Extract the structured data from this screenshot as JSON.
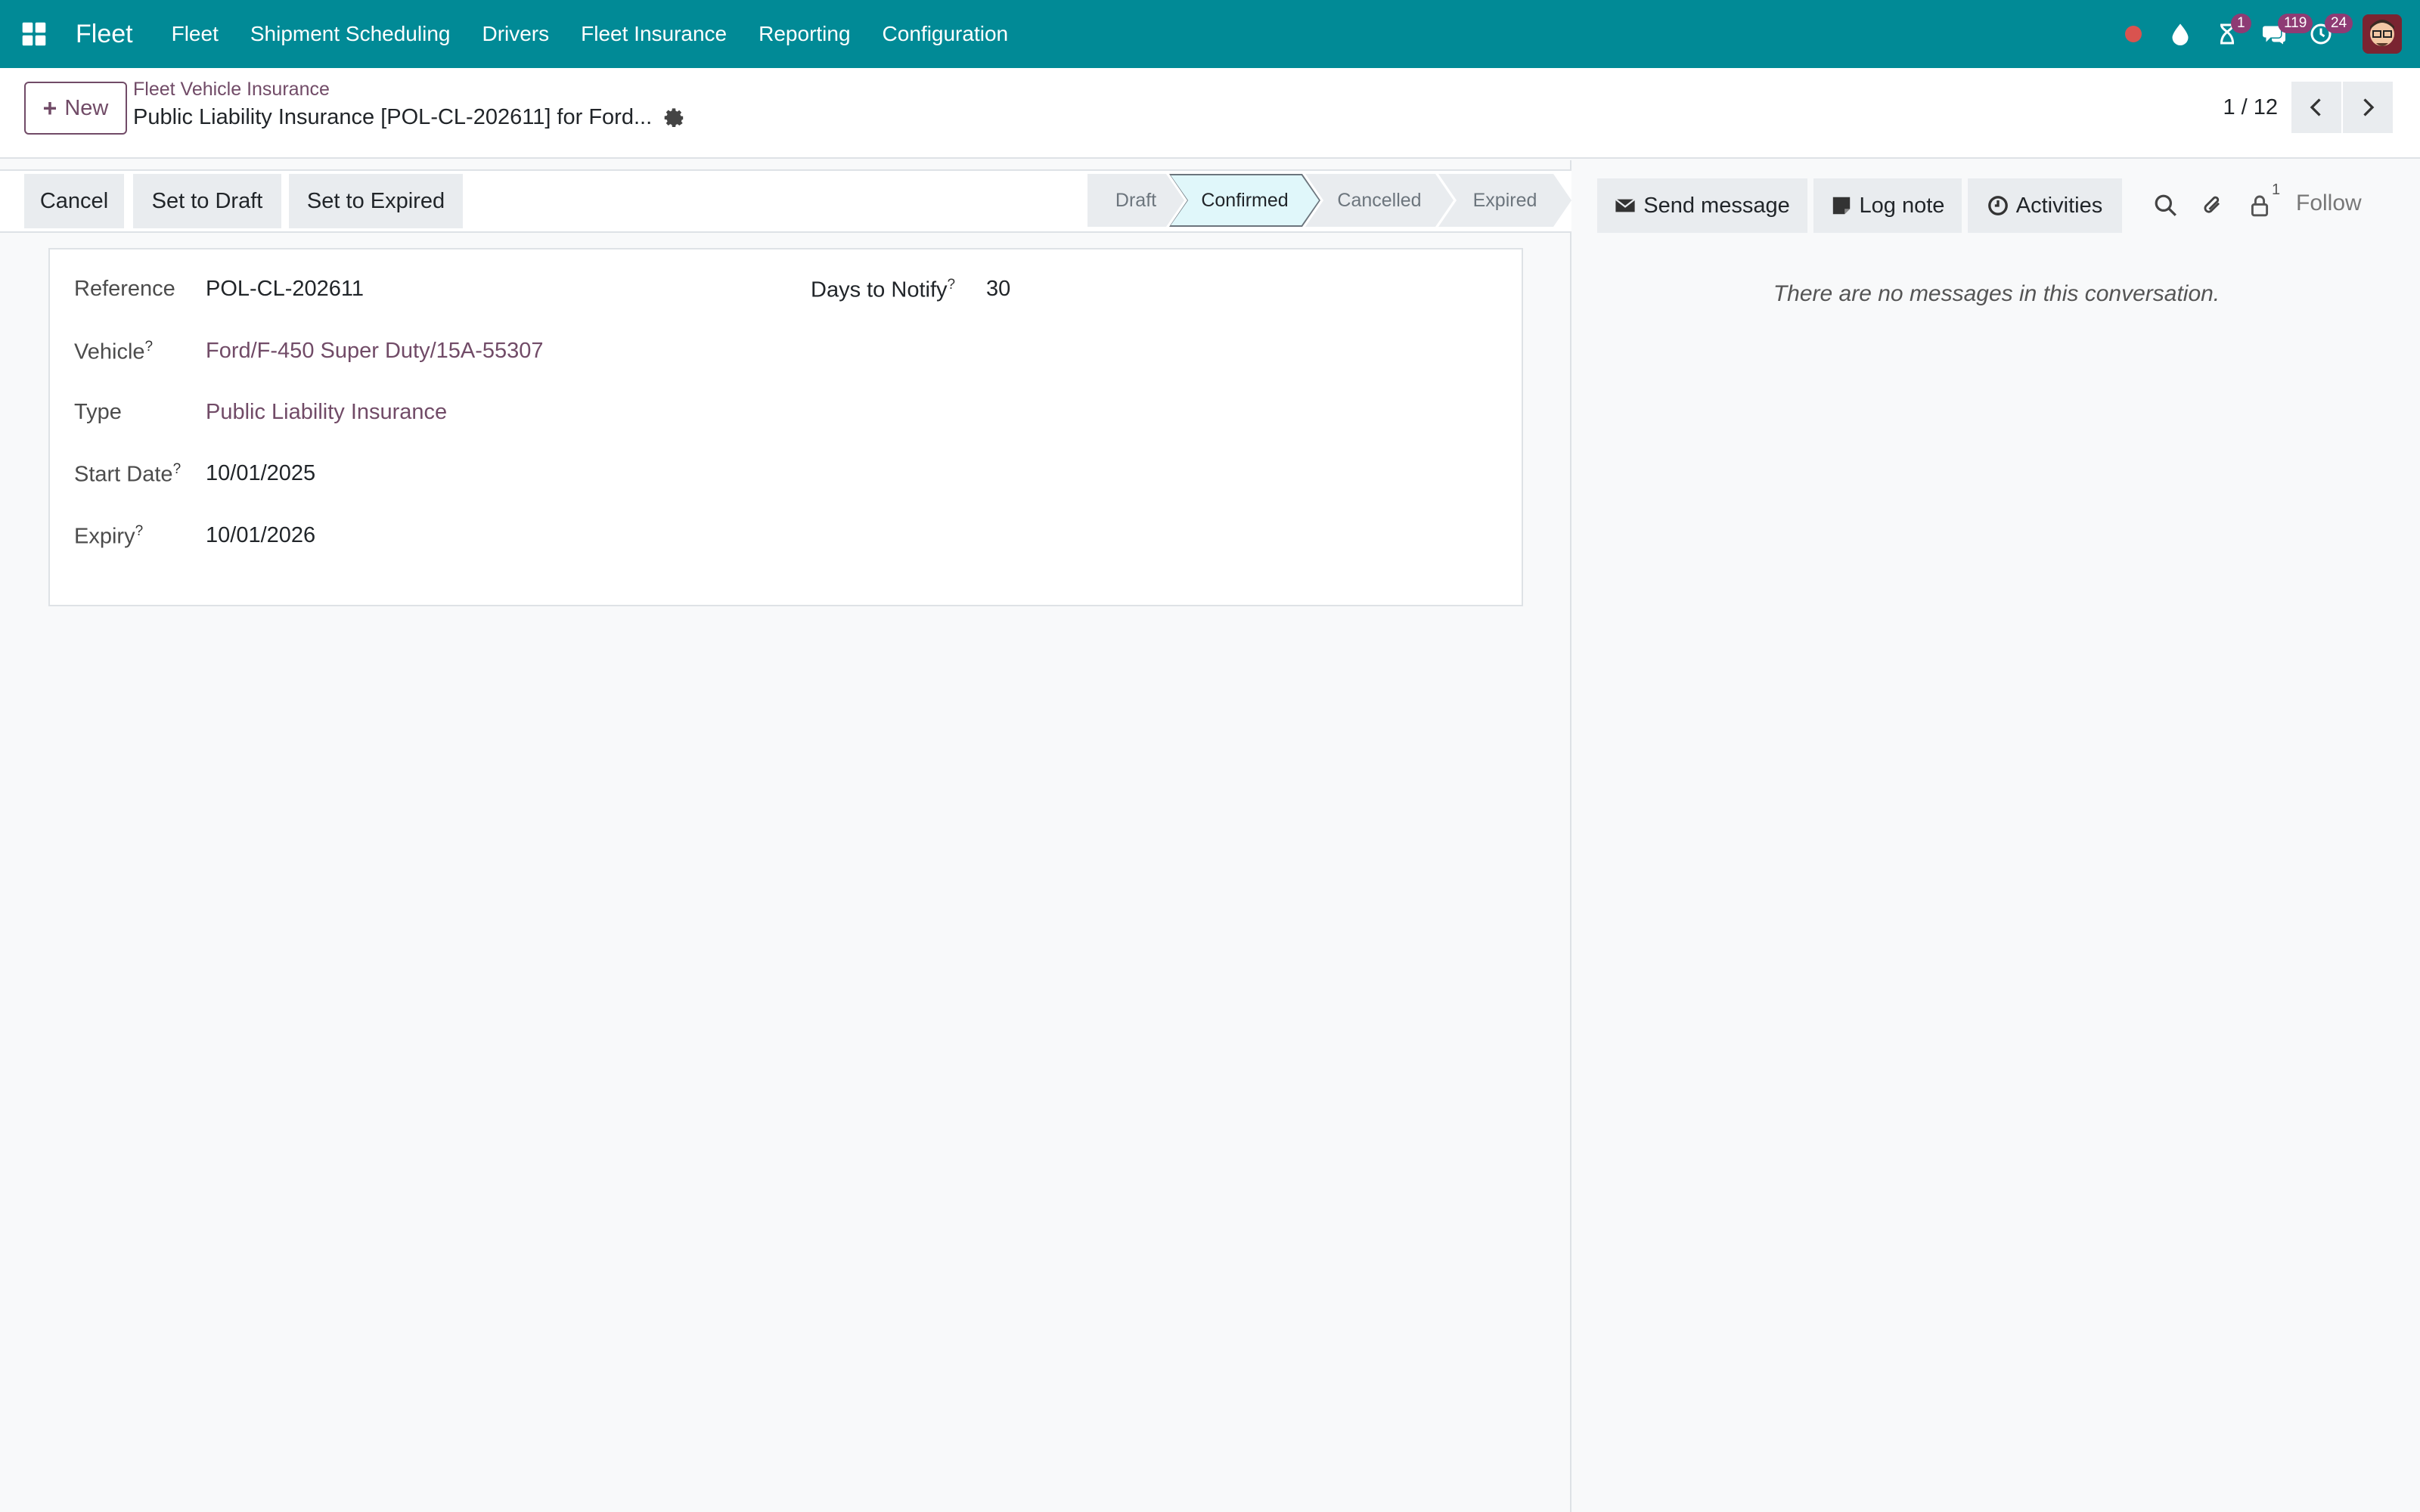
{
  "navbar": {
    "brand": "Fleet",
    "menu": [
      "Fleet",
      "Shipment Scheduling",
      "Drivers",
      "Fleet Insurance",
      "Reporting",
      "Configuration"
    ],
    "badges": {
      "activities": "1",
      "messages": "119",
      "updates": "24"
    }
  },
  "control_panel": {
    "new_label": "New",
    "breadcrumb_parent": "Fleet Vehicle Insurance",
    "breadcrumb_current": "Public Liability Insurance [POL-CL-202611] for Ford...",
    "pager_value": "1 / 12"
  },
  "statusbar": {
    "buttons": [
      "Cancel",
      "Set to Draft",
      "Set to Expired"
    ],
    "stages": [
      "Draft",
      "Confirmed",
      "Cancelled",
      "Expired"
    ],
    "active_stage": "Confirmed"
  },
  "form": {
    "reference_label": "Reference",
    "reference_value": "POL-CL-202611",
    "days_label": "Days to Notify",
    "days_value": "30",
    "vehicle_label": "Vehicle",
    "vehicle_value": "Ford/F-450 Super Duty/15A-55307",
    "type_label": "Type",
    "type_value": "Public Liability Insurance",
    "start_label": "Start Date",
    "start_value": "10/01/2025",
    "expiry_label": "Expiry",
    "expiry_value": "10/01/2026",
    "help_mark": "?"
  },
  "chatter": {
    "send_message": "Send message",
    "log_note": "Log note",
    "activities": "Activities",
    "follower_count": "1",
    "follow": "Follow",
    "empty_text": "There are no messages in this conversation."
  },
  "colors": {
    "navbar": "#018a96",
    "brand_purple": "#714b67",
    "badge": "#8e3b74",
    "active_stage": "#e0f7fa"
  }
}
